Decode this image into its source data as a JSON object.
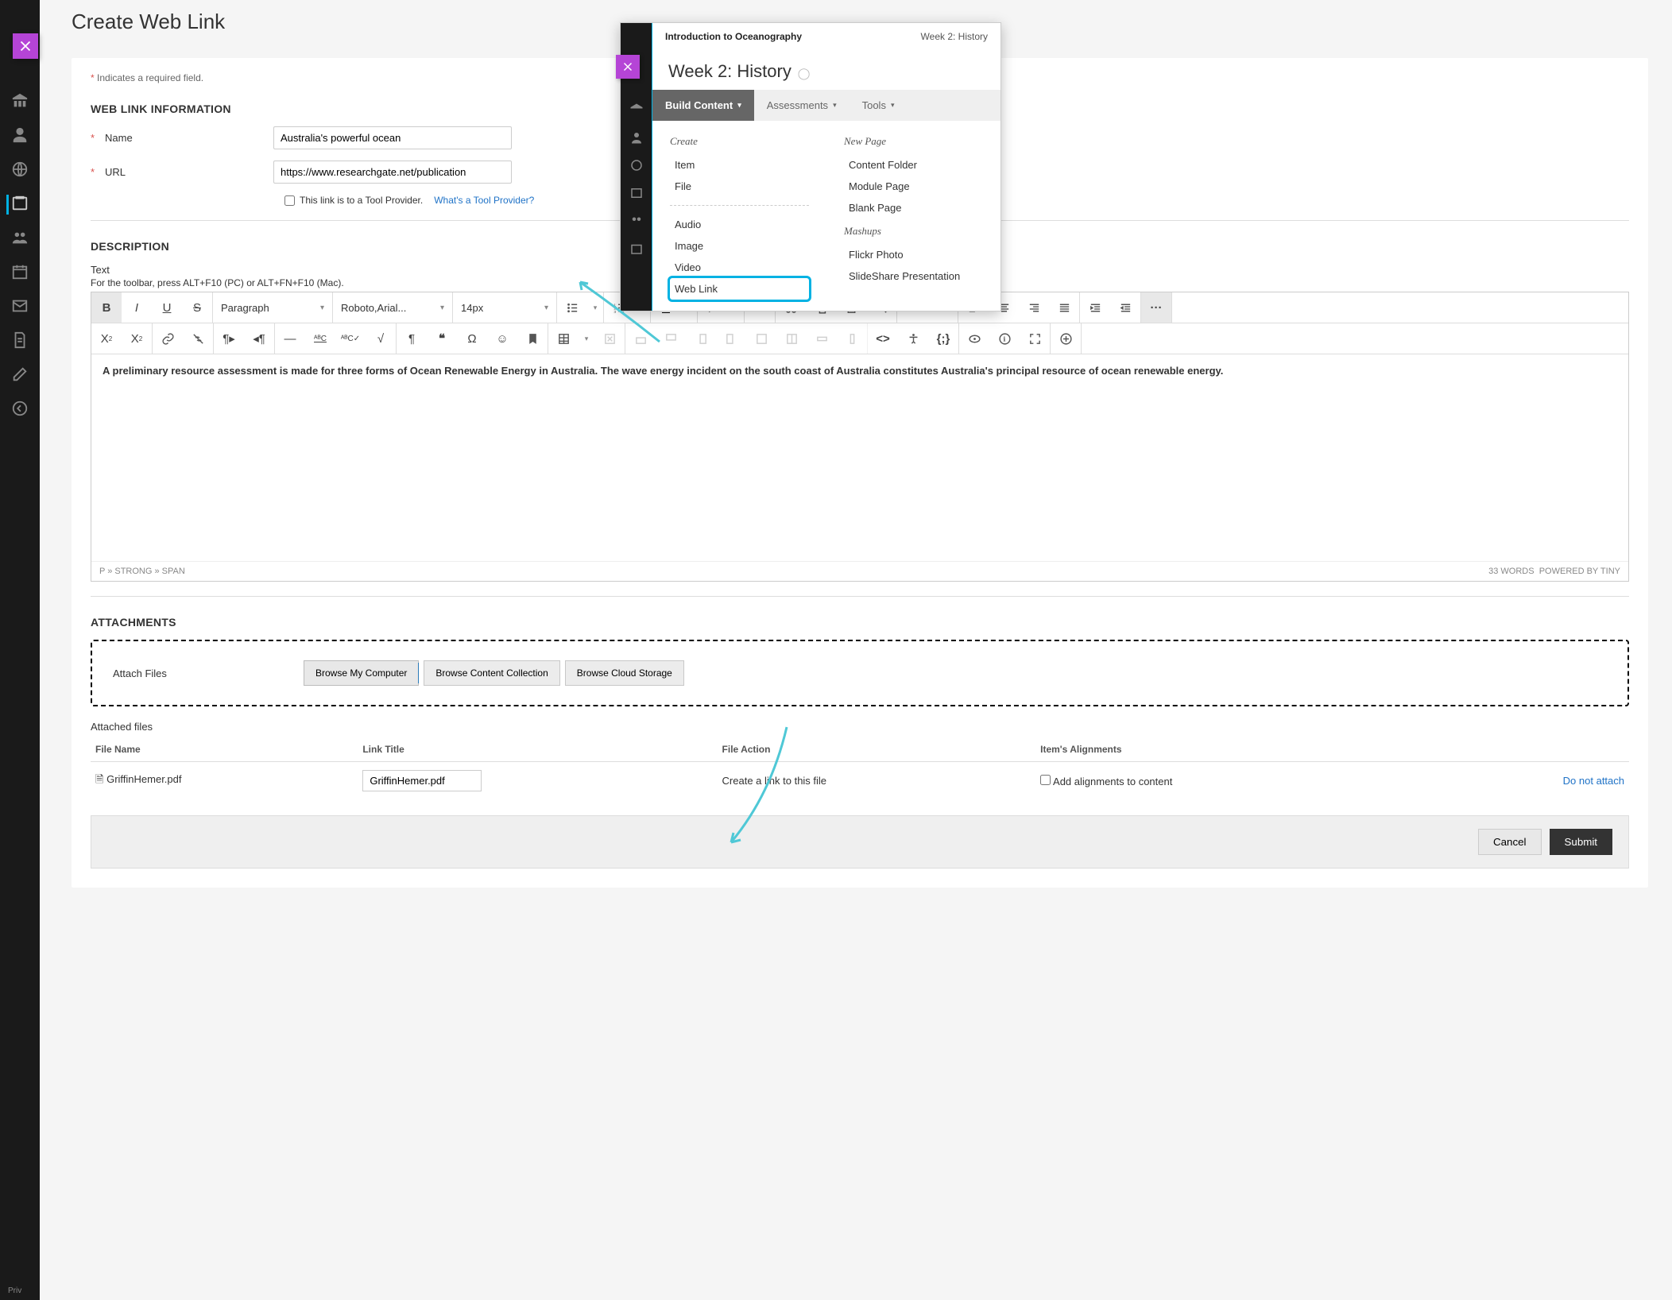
{
  "page_title": "Create Web Link",
  "required_note": "Indicates a required field.",
  "sections": {
    "info": "WEB LINK INFORMATION",
    "desc": "DESCRIPTION",
    "attach": "ATTACHMENTS"
  },
  "fields": {
    "name_label": "Name",
    "name_value": "Australia's powerful ocean",
    "url_label": "URL",
    "url_value": "https://www.researchgate.net/publication",
    "tool_provider_label": "This link is to a Tool Provider.",
    "tool_provider_help": "What's a Tool Provider?"
  },
  "editor": {
    "text_label": "Text",
    "toolbar_tip": "For the toolbar, press ALT+F10 (PC) or ALT+FN+F10 (Mac).",
    "block": "Paragraph",
    "font": "Roboto,Arial...",
    "size": "14px",
    "body": "A preliminary resource assessment is made for three forms of Ocean Renewable Energy in Australia. The wave energy incident on the south coast of Australia constitutes Australia's principal resource of ocean renewable energy.",
    "path": "P » STRONG » SPAN",
    "wordcount": "33 WORDS",
    "powered": "POWERED BY TINY"
  },
  "attachments": {
    "attach_label": "Attach Files",
    "browse_computer": "Browse My Computer",
    "browse_collection": "Browse Content Collection",
    "browse_cloud": "Browse Cloud Storage",
    "list_head": "Attached files",
    "cols": {
      "file": "File Name",
      "title": "Link Title",
      "action": "File Action",
      "align": "Item's Alignments"
    },
    "row": {
      "file": "GriffinHemer.pdf",
      "title": "GriffinHemer.pdf",
      "action": "Create a link to this file",
      "align": "Add alignments to content",
      "remove": "Do not attach"
    }
  },
  "footer": {
    "cancel": "Cancel",
    "submit": "Submit"
  },
  "popover": {
    "crumb_course": "Introduction to Oceanography",
    "crumb_page": "Week 2: History",
    "title": "Week 2: History",
    "tabs": {
      "build": "Build Content",
      "assess": "Assessments",
      "tools": "Tools"
    },
    "col1_head": "Create",
    "col1": [
      "Item",
      "File",
      "Audio",
      "Image",
      "Video",
      "Web Link"
    ],
    "col2_head1": "New Page",
    "col2a": [
      "Content Folder",
      "Module Page",
      "Blank Page"
    ],
    "col2_head2": "Mashups",
    "col2b": [
      "Flickr Photo",
      "SlideShare Presentation"
    ]
  },
  "priv": "Priv"
}
